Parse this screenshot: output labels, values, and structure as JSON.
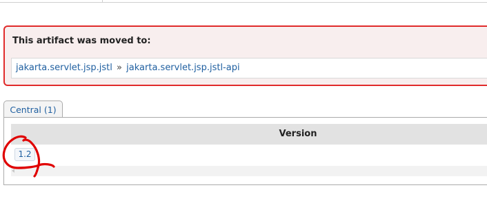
{
  "notice": {
    "title": "This artifact was moved to:",
    "group_link": "jakarta.servlet.jsp.jstl",
    "separator": "»",
    "artifact_link": "jakarta.servlet.jsp.jstl-api"
  },
  "repo_tabs": [
    {
      "label": "Central (1)",
      "selected": true
    }
  ],
  "versions_table": {
    "header": "Version",
    "rows": [
      {
        "version": "1.2"
      }
    ]
  },
  "colors": {
    "alert_border": "#e02a2a",
    "alert_background": "#f8eeee",
    "link": "#1f5fa0",
    "annotation": "#e00000"
  }
}
